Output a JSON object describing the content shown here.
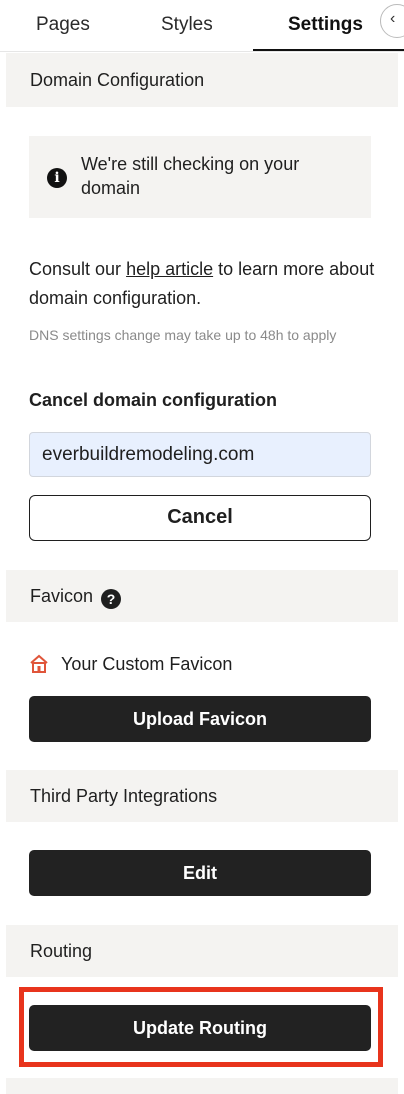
{
  "tabs": [
    {
      "label": "Pages"
    },
    {
      "label": "Styles"
    },
    {
      "label": "Settings",
      "active": true
    }
  ],
  "domain_section": {
    "title": "Domain Configuration",
    "notice_text": "We're still checking on your domain",
    "consult_prefix": "Consult our ",
    "consult_link": "help article",
    "consult_suffix": " to learn more about domain configuration.",
    "dns_note": "DNS settings change may take up to 48h to apply",
    "cancel_heading": "Cancel domain configuration",
    "domain_value": "everbuildremodeling.com",
    "cancel_button": "Cancel"
  },
  "favicon_section": {
    "title": "Favicon",
    "help_icon": "?",
    "label": "Your Custom Favicon",
    "upload_button": "Upload Favicon"
  },
  "integrations_section": {
    "title": "Third Party Integrations",
    "edit_button": "Edit"
  },
  "routing_section": {
    "title": "Routing",
    "update_button": "Update Routing"
  },
  "colors": {
    "accent_highlight": "#e8341c",
    "dark_button": "#222222",
    "section_bg": "#f4f3f1",
    "input_bg": "#e8f0fe"
  }
}
